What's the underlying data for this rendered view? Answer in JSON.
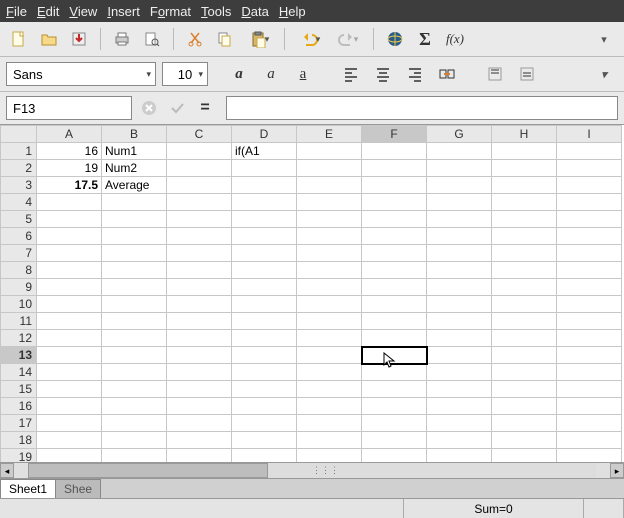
{
  "menu": {
    "file": "File",
    "edit": "Edit",
    "view": "View",
    "insert": "Insert",
    "format": "Format",
    "tools": "Tools",
    "data": "Data",
    "help": "Help"
  },
  "font": {
    "name": "Sans",
    "size": "10"
  },
  "cellref": "F13",
  "formula": "",
  "columns": [
    "A",
    "B",
    "C",
    "D",
    "E",
    "F",
    "G",
    "H",
    "I"
  ],
  "active_col": "F",
  "active_row": 13,
  "row_count": 19,
  "cells": {
    "A1": "16",
    "B1": "Num1",
    "D1": "if(A1",
    "A2": "19",
    "B2": "Num2",
    "A3": "17.5",
    "B3": "Average"
  },
  "tabs": [
    "Sheet1",
    "Shee"
  ],
  "status": {
    "sum": "Sum=0"
  },
  "chart_data": {
    "type": "table",
    "columns": [
      "A",
      "B",
      "C",
      "D"
    ],
    "rows": [
      {
        "A": 16,
        "B": "Num1",
        "D": "if(A1"
      },
      {
        "A": 19,
        "B": "Num2"
      },
      {
        "A": 17.5,
        "B": "Average"
      }
    ]
  }
}
